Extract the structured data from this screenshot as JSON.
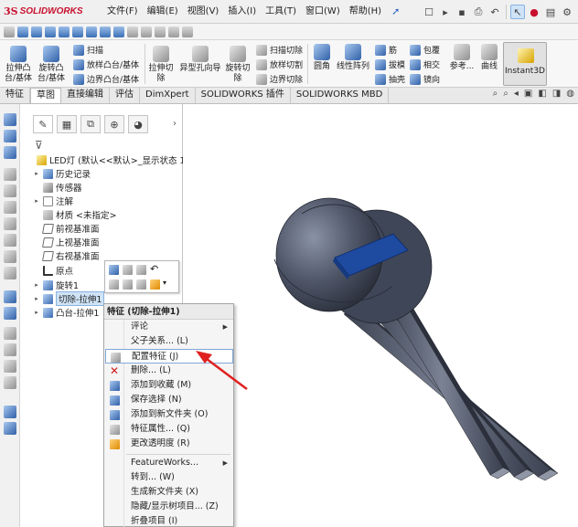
{
  "app": {
    "brand": "SOLIDWORKS",
    "ds": "3S"
  },
  "menu": {
    "items": [
      "文件(F)",
      "编辑(E)",
      "视图(V)",
      "插入(I)",
      "工具(T)",
      "窗口(W)",
      "帮助(H)"
    ],
    "pin": "✚"
  },
  "quick_access": {
    "icons": [
      "new-doc-icon",
      "open-icon",
      "save-icon",
      "print-icon",
      "undo-icon",
      "select-icon",
      "traffic-light-icon",
      "options-icon"
    ]
  },
  "command_manager": {
    "extrude_boss": "拉伸凸\n台/基体",
    "revolve_boss": "旋转凸\n台/基体",
    "sweep": "扫描",
    "loft_boss": "放样凸台/基体",
    "boundary_boss": "边界凸台/基体",
    "extrude_cut": "拉伸切\n除",
    "hole_wizard": "异型孔向导",
    "revolve_cut": "旋转切\n除",
    "sweep_cut": "扫描切除",
    "loft_cut": "放样切割",
    "boundary_cut": "边界切除",
    "fillet": "圆角",
    "linear_pattern": "线性阵列",
    "rib": "筋",
    "draft": "拔模",
    "shell": "抽壳",
    "wrap": "包覆",
    "intersect": "相交",
    "mirror": "镜向",
    "reference": "参考...",
    "curves": "曲线",
    "instant3d": "Instant3D"
  },
  "tabs": [
    "特征",
    "草图",
    "直接编辑",
    "评估",
    "DimXpert",
    "SOLIDWORKS 插件",
    "SOLIDWORKS MBD"
  ],
  "active_tab": "特征",
  "tree": {
    "root": "LED灯  (默认<<默认>_显示状态 1>",
    "items": [
      {
        "label": "历史记录",
        "icon": "history-icon",
        "expand": true
      },
      {
        "label": "传感器",
        "icon": "sensor-icon",
        "expand": false
      },
      {
        "label": "注解",
        "icon": "annotation-icon",
        "expand": true
      },
      {
        "label": "材质 <未指定>",
        "icon": "material-icon",
        "expand": false
      },
      {
        "label": "前视基准面",
        "icon": "plane-icon",
        "expand": false
      },
      {
        "label": "上视基准面",
        "icon": "plane-icon",
        "expand": false
      },
      {
        "label": "右视基准面",
        "icon": "plane-icon",
        "expand": false
      },
      {
        "label": "原点",
        "icon": "origin-icon",
        "expand": false
      },
      {
        "label": "旋转1",
        "icon": "revolve-icon",
        "expand": true
      },
      {
        "label": "切除-拉伸1",
        "icon": "cut-extrude-icon",
        "expand": true,
        "selected": true
      },
      {
        "label": "凸台-拉伸1",
        "icon": "boss-extrude-icon",
        "expand": true
      }
    ]
  },
  "context_menu": {
    "title": "特征 (切除-拉伸1)",
    "items": [
      {
        "label": "评论",
        "submenu": true,
        "icon": ""
      },
      {
        "label": "父子关系... (L)",
        "submenu": false,
        "icon": ""
      },
      {
        "label": "配置特征 (J)",
        "submenu": false,
        "icon": "configure-feature-icon",
        "highlight": true
      },
      {
        "label": "删除... (L)",
        "submenu": false,
        "icon": "delete-icon"
      },
      {
        "label": "添加到收藏 (M)",
        "submenu": false,
        "icon": "favorites-icon"
      },
      {
        "label": "保存选择 (N)",
        "submenu": false,
        "icon": "save-selection-icon"
      },
      {
        "label": "添加到新文件夹 (O)",
        "submenu": false,
        "icon": "new-folder-icon"
      },
      {
        "label": "特征属性... (Q)",
        "submenu": false,
        "icon": "feature-properties-icon"
      },
      {
        "label": "更改透明度 (R)",
        "submenu": false,
        "icon": "transparency-icon"
      },
      {
        "label": "FeatureWorks...",
        "submenu": true,
        "icon": ""
      },
      {
        "label": "转到... (W)",
        "submenu": false,
        "icon": ""
      },
      {
        "label": "生成新文件夹 (X)",
        "submenu": false,
        "icon": ""
      },
      {
        "label": "隐藏/显示树项目... (Z)",
        "submenu": false,
        "icon": ""
      },
      {
        "label": "折叠项目 (I)",
        "submenu": false,
        "icon": ""
      }
    ]
  },
  "colors": {
    "highlight_arrow": "#e02020",
    "model_body": "#4b5262",
    "model_face": "#1e4aa0",
    "brand": "#c8102e"
  }
}
